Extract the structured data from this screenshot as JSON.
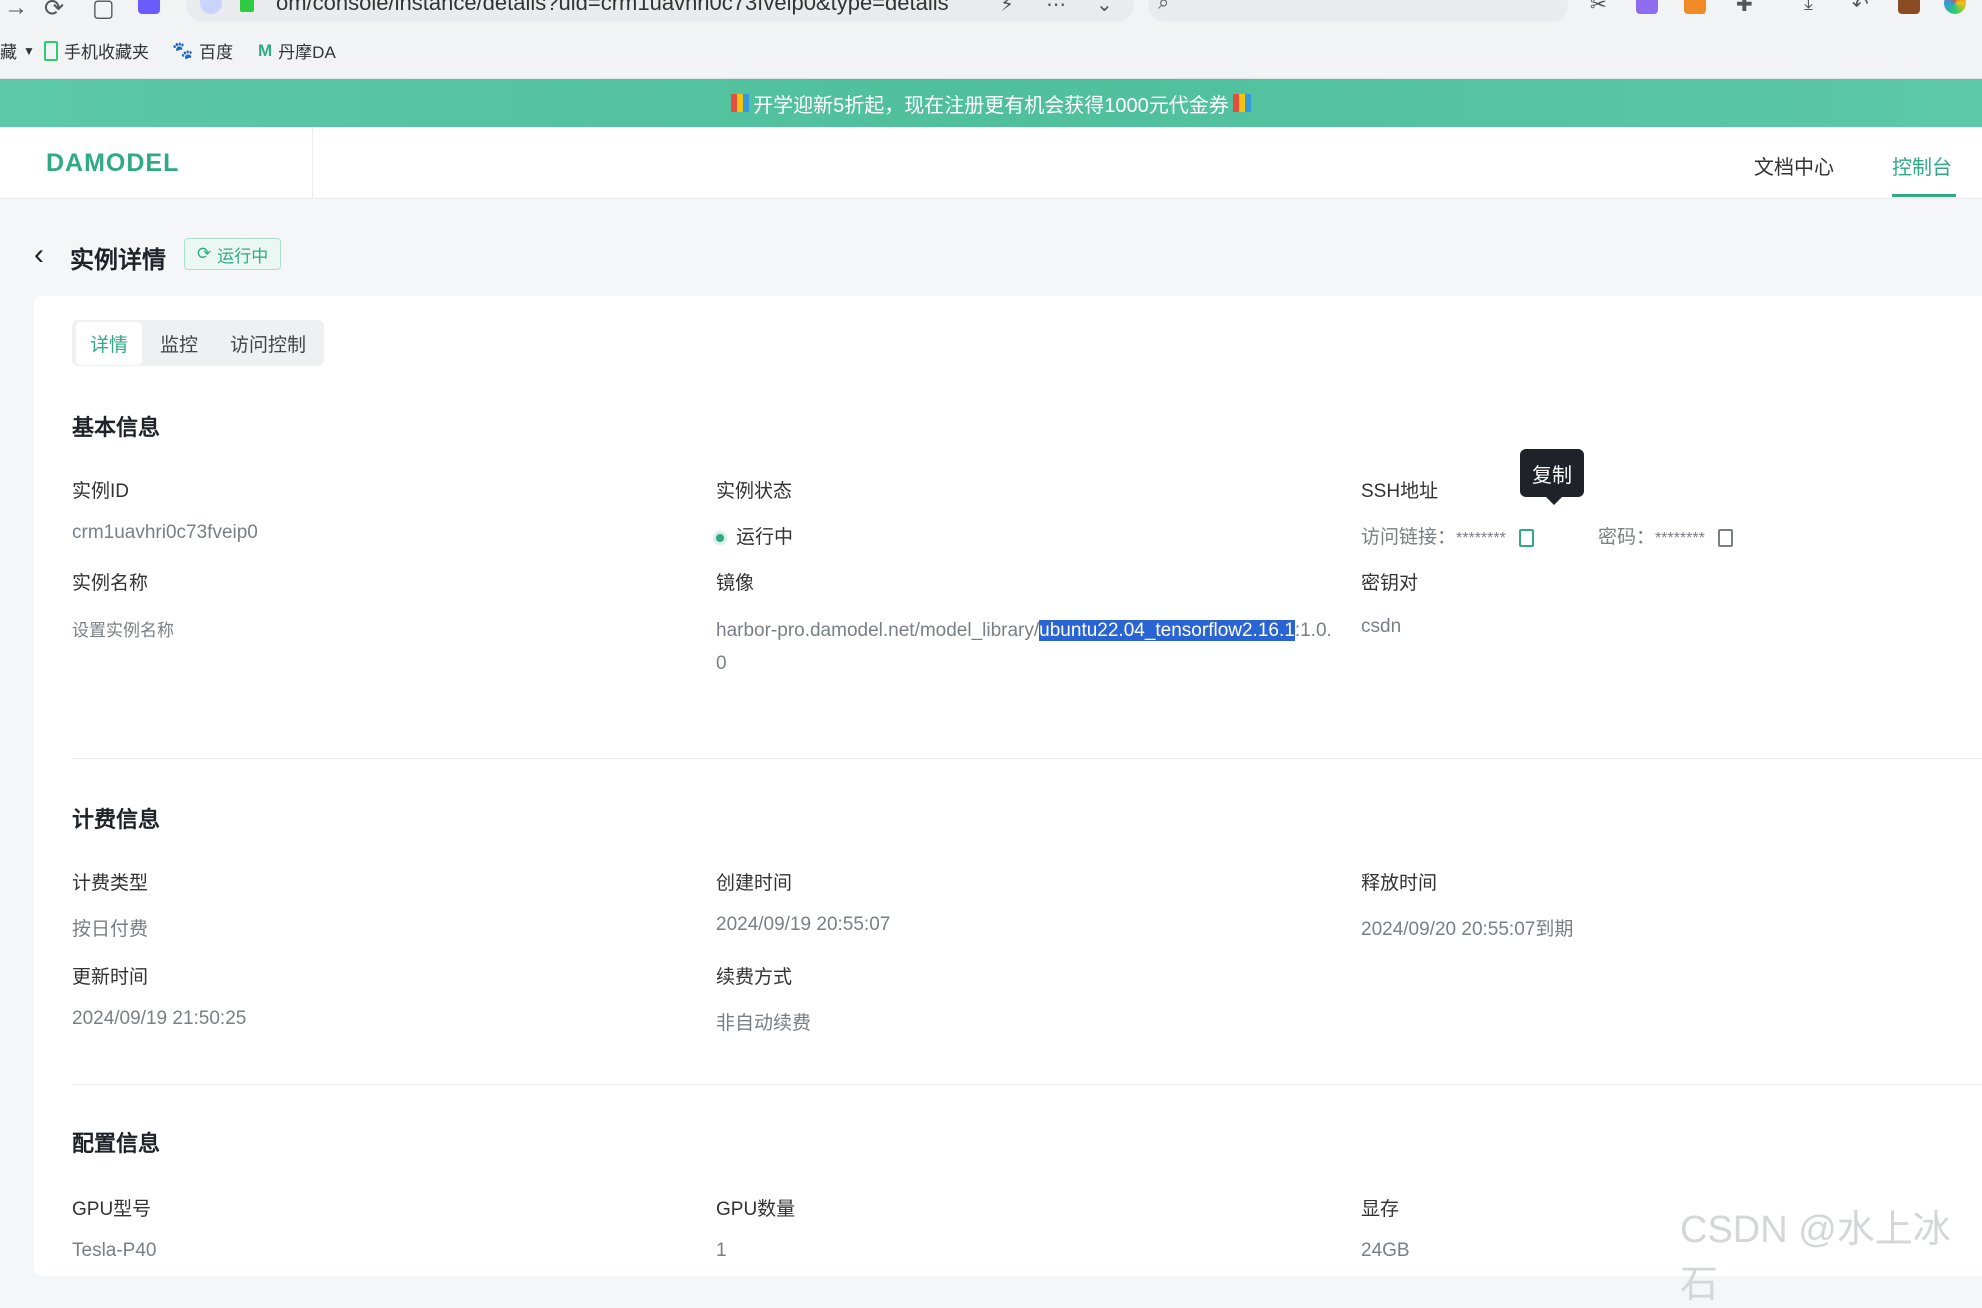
{
  "browser": {
    "url": "om/console/instance/details?uid=crm1uavhri0c73fveip0&type=details",
    "bookmarks": [
      {
        "label": "藏"
      },
      {
        "label": "手机收藏夹"
      },
      {
        "label": "百度"
      },
      {
        "label": "丹摩DA"
      }
    ]
  },
  "promo": {
    "text": "开学迎新5折起，现在注册更有机会获得1000元代金券"
  },
  "site": {
    "logo": "DAMODEL",
    "nav": [
      {
        "label": "文档中心"
      },
      {
        "label": "控制台"
      }
    ]
  },
  "page": {
    "title": "实例详情",
    "status_tag": "运行中",
    "tabs": [
      {
        "label": "详情"
      },
      {
        "label": "监控"
      },
      {
        "label": "访问控制"
      }
    ]
  },
  "basic": {
    "title": "基本信息",
    "instance_id_label": "实例ID",
    "instance_id": "crm1uavhri0c73fveip0",
    "instance_status_label": "实例状态",
    "instance_status": "运行中",
    "ssh_label": "SSH地址",
    "access_link_label": "访问链接：",
    "access_link_value": "********",
    "password_label": "密码：",
    "password_value": "********",
    "name_label": "实例名称",
    "name_placeholder": "设置实例名称",
    "image_label": "镜像",
    "image_prefix": "harbor-pro.damodel.net/model_library/",
    "image_highlight": "ubuntu22.04_tensorflow2.16.1",
    "image_suffix": ":1.0.0",
    "keypair_label": "密钥对",
    "keypair_value": "csdn",
    "tooltip": "复制"
  },
  "billing": {
    "title": "计费信息",
    "type_label": "计费类型",
    "type_value": "按日付费",
    "created_label": "创建时间",
    "created_value": "2024/09/19 20:55:07",
    "release_label": "释放时间",
    "release_value": "2024/09/20 20:55:07到期",
    "updated_label": "更新时间",
    "updated_value": "2024/09/19 21:50:25",
    "renew_label": "续费方式",
    "renew_value": "非自动续费"
  },
  "config": {
    "title": "配置信息",
    "gpu_model_label": "GPU型号",
    "gpu_model_value": "Tesla-P40",
    "gpu_count_label": "GPU数量",
    "gpu_count_value": "1",
    "vram_label": "显存",
    "vram_value": "24GB"
  },
  "watermark": "CSDN @水上冰石",
  "colors": {
    "accent": "#2faa85",
    "banner": "#5cc8a8",
    "selection": "#2a63d4"
  }
}
